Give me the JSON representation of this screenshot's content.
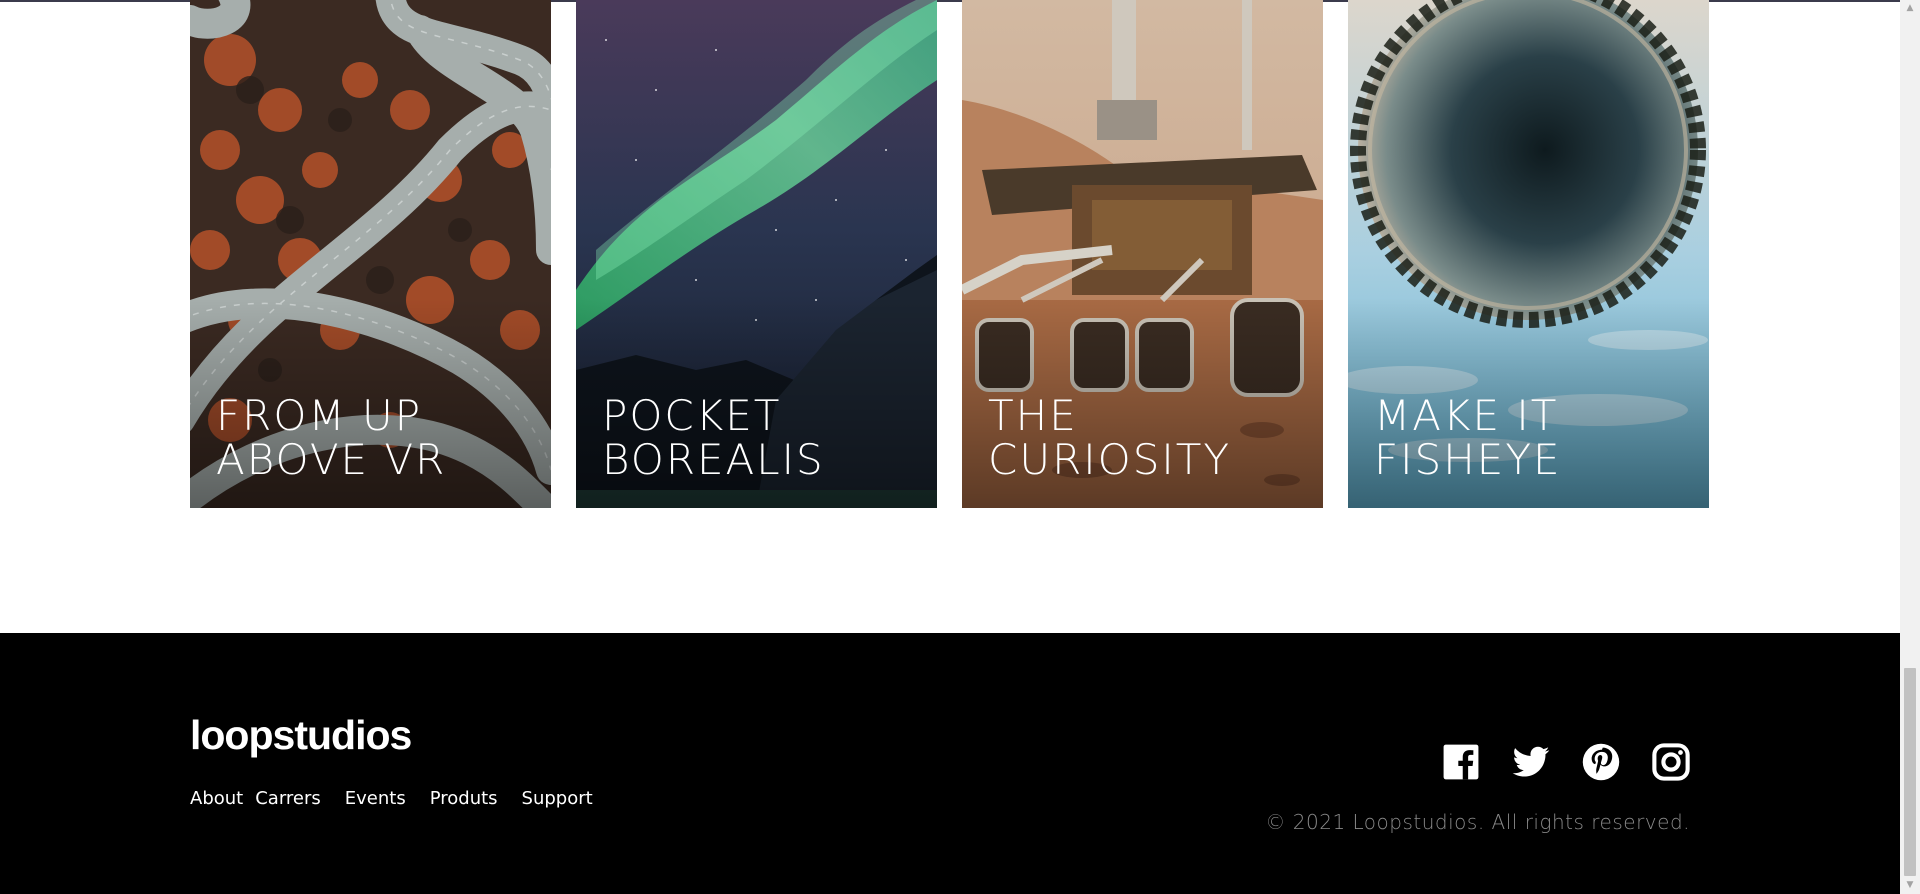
{
  "creations": [
    {
      "title": "FROM UP\nABOVE VR"
    },
    {
      "title": "POCKET\nBOREALIS"
    },
    {
      "title": "THE\nCURIOSITY"
    },
    {
      "title": "MAKE IT\nFISHEYE"
    }
  ],
  "footer": {
    "logo": "loopstudios",
    "nav": [
      "About",
      "Carrers",
      "Events",
      "Produts",
      "Support"
    ],
    "socials": [
      "facebook-icon",
      "twitter-icon",
      "pinterest-icon",
      "instagram-icon"
    ],
    "copyright": "© 2021 Loopstudios. All rights reserved."
  },
  "colors": {
    "footer_bg": "#000000",
    "text_light": "#ffffff",
    "copyright_grey": "#8a8a8a"
  }
}
